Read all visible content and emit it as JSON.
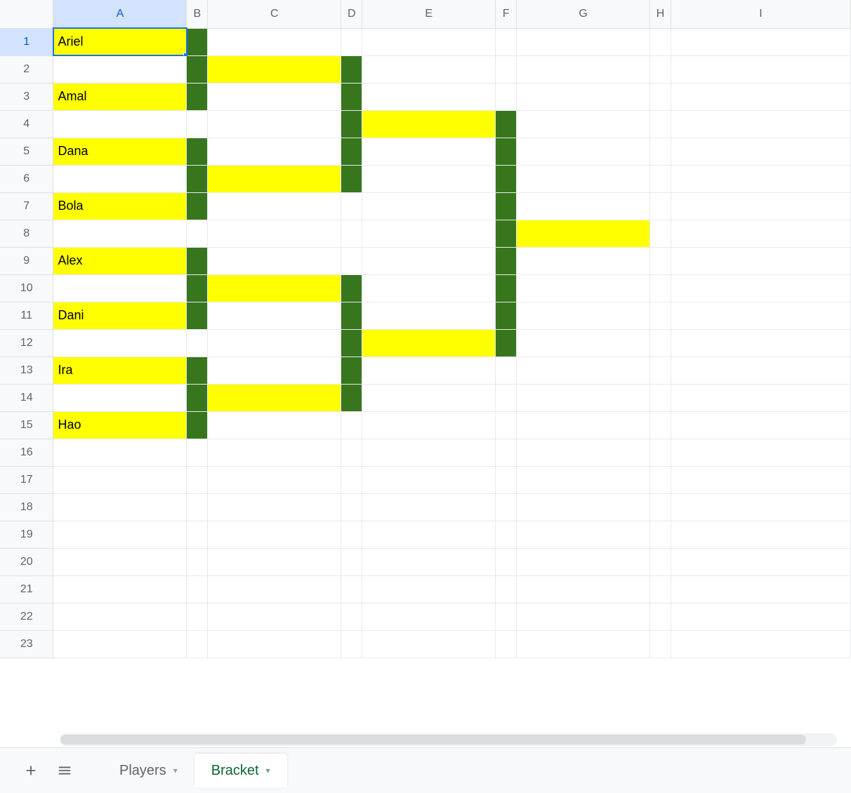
{
  "columns": [
    "A",
    "B",
    "C",
    "D",
    "E",
    "F",
    "G",
    "H",
    "I"
  ],
  "rowCount": 23,
  "selectedCell": {
    "row": 1,
    "col": "A"
  },
  "colors": {
    "yellow": "#ffff00",
    "green": "#38761d",
    "selection": "#1a73e8"
  },
  "cells": {
    "A1": {
      "value": "Ariel",
      "bg": "yellow"
    },
    "B1": {
      "value": "",
      "bg": "green"
    },
    "B2": {
      "value": "",
      "bg": "green"
    },
    "C2": {
      "value": "",
      "bg": "yellow"
    },
    "D2": {
      "value": "",
      "bg": "green"
    },
    "A3": {
      "value": "Amal",
      "bg": "yellow"
    },
    "B3": {
      "value": "",
      "bg": "green"
    },
    "D3": {
      "value": "",
      "bg": "green"
    },
    "D4": {
      "value": "",
      "bg": "green"
    },
    "E4": {
      "value": "",
      "bg": "yellow"
    },
    "F4": {
      "value": "",
      "bg": "green"
    },
    "A5": {
      "value": "Dana",
      "bg": "yellow"
    },
    "B5": {
      "value": "",
      "bg": "green"
    },
    "D5": {
      "value": "",
      "bg": "green"
    },
    "F5": {
      "value": "",
      "bg": "green"
    },
    "B6": {
      "value": "",
      "bg": "green"
    },
    "C6": {
      "value": "",
      "bg": "yellow"
    },
    "D6": {
      "value": "",
      "bg": "green"
    },
    "F6": {
      "value": "",
      "bg": "green"
    },
    "A7": {
      "value": "Bola",
      "bg": "yellow"
    },
    "B7": {
      "value": "",
      "bg": "green"
    },
    "F7": {
      "value": "",
      "bg": "green"
    },
    "F8": {
      "value": "",
      "bg": "green"
    },
    "G8": {
      "value": "",
      "bg": "yellow"
    },
    "A9": {
      "value": "Alex",
      "bg": "yellow"
    },
    "B9": {
      "value": "",
      "bg": "green"
    },
    "F9": {
      "value": "",
      "bg": "green"
    },
    "B10": {
      "value": "",
      "bg": "green"
    },
    "C10": {
      "value": "",
      "bg": "yellow"
    },
    "D10": {
      "value": "",
      "bg": "green"
    },
    "F10": {
      "value": "",
      "bg": "green"
    },
    "A11": {
      "value": "Dani",
      "bg": "yellow"
    },
    "B11": {
      "value": "",
      "bg": "green"
    },
    "D11": {
      "value": "",
      "bg": "green"
    },
    "F11": {
      "value": "",
      "bg": "green"
    },
    "D12": {
      "value": "",
      "bg": "green"
    },
    "E12": {
      "value": "",
      "bg": "yellow"
    },
    "F12": {
      "value": "",
      "bg": "green"
    },
    "A13": {
      "value": "Ira",
      "bg": "yellow"
    },
    "B13": {
      "value": "",
      "bg": "green"
    },
    "D13": {
      "value": "",
      "bg": "green"
    },
    "B14": {
      "value": "",
      "bg": "green"
    },
    "C14": {
      "value": "",
      "bg": "yellow"
    },
    "D14": {
      "value": "",
      "bg": "green"
    },
    "A15": {
      "value": "Hao",
      "bg": "yellow"
    },
    "B15": {
      "value": "",
      "bg": "green"
    }
  },
  "tabs": {
    "add_tooltip": "Add Sheet",
    "all_tooltip": "All Sheets",
    "sheets": [
      {
        "name": "Players",
        "active": false
      },
      {
        "name": "Bracket",
        "active": true
      }
    ]
  }
}
